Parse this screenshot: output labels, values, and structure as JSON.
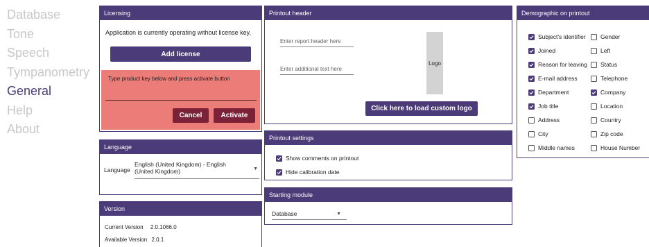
{
  "nav": {
    "items": [
      "Database",
      "Tone",
      "Speech",
      "Tympanometry",
      "General",
      "Help",
      "About"
    ],
    "active_index": 4
  },
  "licensing": {
    "header": "Licensing",
    "status_text": "Application is currently operating without license key.",
    "add_license_label": "Add license",
    "key_prompt": "Type product key below and press activate button",
    "key_value": "",
    "cancel_label": "Cancel",
    "activate_label": "Activate"
  },
  "language": {
    "header": "Language",
    "label": "Language",
    "selected": "English (United Kingdom) - English (United Kingdom)"
  },
  "version": {
    "header": "Version",
    "current_label": "Current Version",
    "current_value": "2.0.1066.0",
    "available_label": "Available Version",
    "available_value": "2.0.1"
  },
  "printout_header": {
    "header": "Printout header",
    "report_header_placeholder": "Enter report header here",
    "additional_text_placeholder": "Enter additional text here",
    "logo_label": "Logo",
    "load_logo_label": "Click here  to load custom logo"
  },
  "printout_settings": {
    "header": "Printout settings",
    "options": [
      {
        "label": "Show comments on printout",
        "checked": true
      },
      {
        "label": "Hide calibration date",
        "checked": true
      }
    ]
  },
  "starting_module": {
    "header": "Starting module",
    "selected": "Database"
  },
  "demographic": {
    "header": "Demographic on printout",
    "left_column": [
      {
        "label": "Subject's identifier",
        "checked": true
      },
      {
        "label": "Joined",
        "checked": true
      },
      {
        "label": "Reason for leaving",
        "checked": true
      },
      {
        "label": "E-mail address",
        "checked": true
      },
      {
        "label": "Department",
        "checked": true
      },
      {
        "label": "Job title",
        "checked": true
      },
      {
        "label": "Address",
        "checked": false
      },
      {
        "label": "City",
        "checked": false
      },
      {
        "label": "Middle names",
        "checked": false
      }
    ],
    "right_column": [
      {
        "label": "Gender",
        "checked": false
      },
      {
        "label": "Left",
        "checked": false
      },
      {
        "label": "Status",
        "checked": false
      },
      {
        "label": "Telephone",
        "checked": false
      },
      {
        "label": "Company",
        "checked": true
      },
      {
        "label": "Location",
        "checked": false
      },
      {
        "label": "Country",
        "checked": false
      },
      {
        "label": "Zip code",
        "checked": false
      },
      {
        "label": "House Number",
        "checked": false
      }
    ]
  },
  "colors": {
    "accent": "#4b3b78",
    "warning_panel": "#ec7c78",
    "danger_button": "#7c2238",
    "nav_inactive": "#c8c8c8"
  }
}
